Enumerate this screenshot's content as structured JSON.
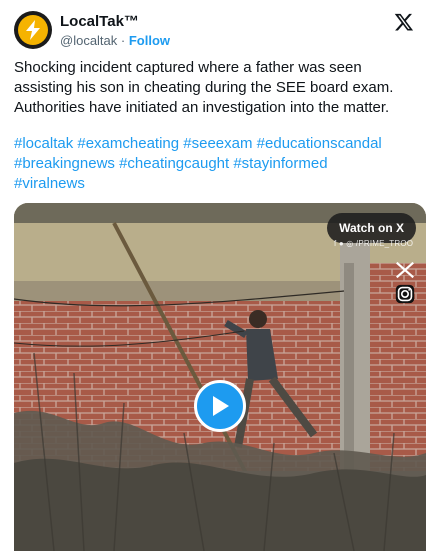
{
  "account": {
    "display_name": "LocalTak™",
    "handle": "@localtak",
    "separator": " · ",
    "follow_label": "Follow",
    "avatar_icon": "bolt-icon",
    "brand_color": "#f5b301"
  },
  "tweet": {
    "text": "Shocking incident captured where a father was seen assisting his son in cheating during the SEE board exam. Authorities have initiated an investigation into the matter.",
    "hashtags": [
      "#localtak",
      "#examcheating",
      "#seeexam",
      "#educationscandal",
      "#breakingnews",
      "#cheatingcaught",
      "#stayinformed",
      "#viralnews"
    ]
  },
  "media": {
    "watch_label": "Watch on X",
    "overlay_text": "f ● ◎ /PRIME_TROO",
    "icons": [
      "x-logo-icon",
      "instagram-icon",
      "play-icon"
    ],
    "accent_color": "#1d9bf0"
  }
}
